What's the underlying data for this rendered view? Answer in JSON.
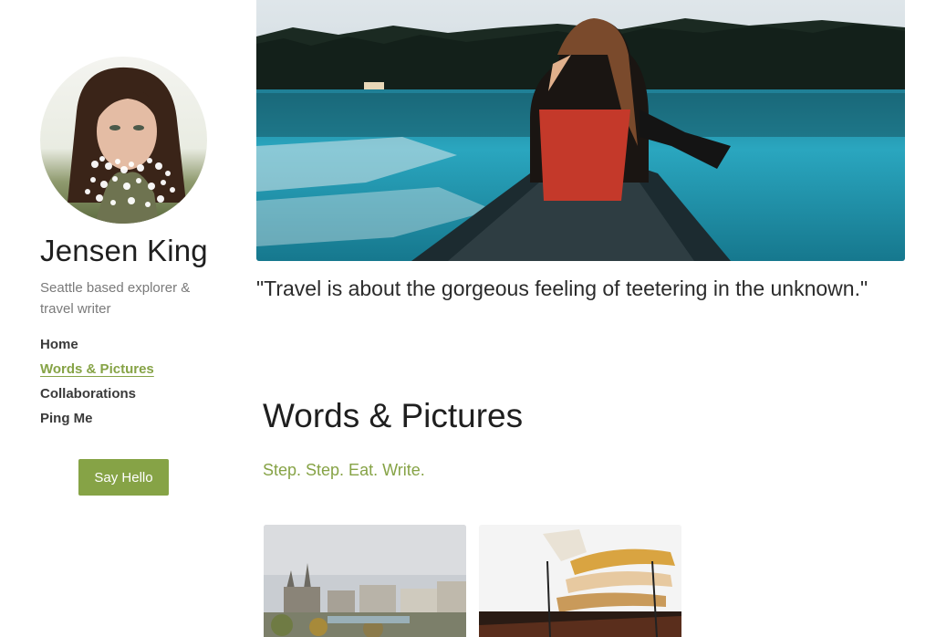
{
  "profile": {
    "name": "Jensen King",
    "tagline": "Seattle based explorer & travel writer",
    "avatar_icon": "portrait-photo-icon"
  },
  "nav": {
    "items": [
      {
        "label": "Home",
        "active": false
      },
      {
        "label": "Words & Pictures",
        "active": true
      },
      {
        "label": "Collaborations",
        "active": false
      },
      {
        "label": "Ping Me",
        "active": false
      }
    ]
  },
  "cta": {
    "label": "Say Hello"
  },
  "hero": {
    "image": "canoe-lake-photo",
    "quote": "\"Travel is about the gorgeous feeling of teetering in the unknown.\""
  },
  "section": {
    "title": "Words & Pictures",
    "subtitle": "Step. Step. Eat. Write."
  },
  "gallery": [
    {
      "image": "paris-cityscape-photo"
    },
    {
      "image": "food-grill-photo"
    }
  ],
  "colors": {
    "accent": "#86a346",
    "text": "#2b2b2b",
    "muted": "#7a7a7a"
  }
}
